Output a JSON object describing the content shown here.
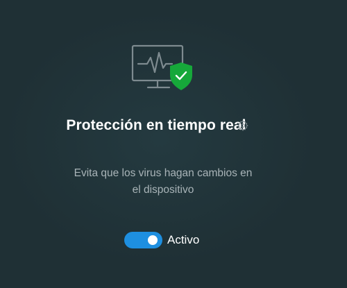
{
  "section": {
    "title": "Protección en tiempo real",
    "description": "Evita que los virus hagan cambios en el dispositivo",
    "icon": "monitor-heartbeat-shield-icon",
    "settings_icon": "gear-icon"
  },
  "toggle": {
    "state": true,
    "label": "Activo"
  },
  "colors": {
    "background": "#1f3035",
    "accent": "#1e8fe0",
    "shield": "#16a83a"
  }
}
